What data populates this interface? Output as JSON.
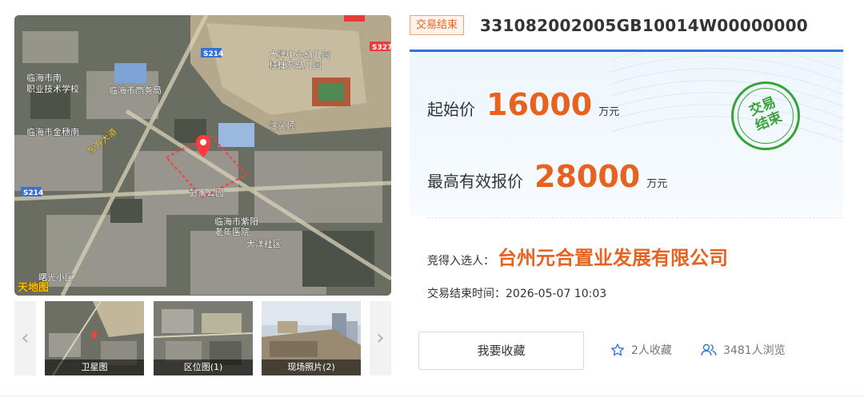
{
  "status_tag": "交易结束",
  "lot_code": "331082002005GB10014W00000000",
  "map": {
    "road_labels": [
      "S214",
      "S214",
      "S327",
      "S214"
    ],
    "place_labels": [
      "临海市南",
      "职业技术学校",
      "临海市商务局",
      "大洋中心幼儿园",
      "桂柱东幼儿园",
      "临海市金穗南",
      "汪头顶",
      "东方大道",
      "彭家公园",
      "大洋社区",
      "临海市紫阳",
      "老年医院",
      "曙光小区"
    ],
    "brand": "天地图"
  },
  "thumbnails": [
    {
      "caption": "卫星图"
    },
    {
      "caption": "区位图(1)"
    },
    {
      "caption": "现场照片(2)"
    }
  ],
  "nav": {
    "prev": "‹",
    "next": "›"
  },
  "price": {
    "start_label": "起始价",
    "start_value": "16000",
    "start_unit": "万元",
    "max_label": "最高有效报价",
    "max_value": "28000",
    "max_unit": "万元"
  },
  "stamp": {
    "line1": "交易",
    "line2": "结束"
  },
  "winner": {
    "label": "竞得入选人：",
    "name": "台州元合置业发展有限公司"
  },
  "end_time": "交易结束时间：2026-05-07 10:03",
  "actions": {
    "favorite_button": "我要收藏"
  },
  "stats": {
    "favorites": "2人收藏",
    "views": "3481人浏览"
  },
  "colors": {
    "accent_orange": "#e8621f",
    "accent_blue": "#2f73d8",
    "stamp_green": "#36a336"
  }
}
